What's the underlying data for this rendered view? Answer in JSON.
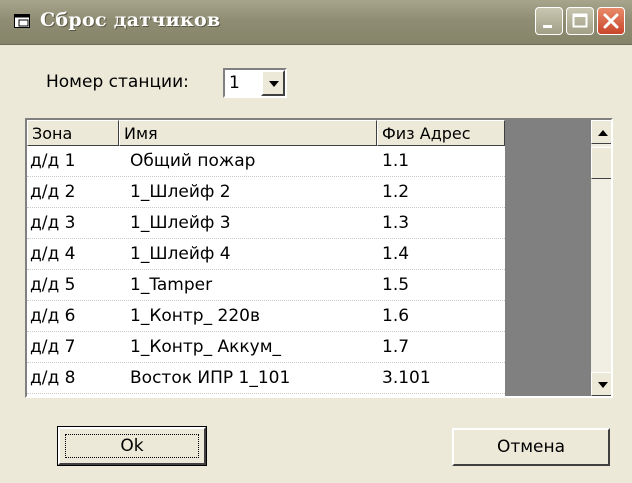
{
  "window": {
    "title": "Сброс датчиков",
    "accent_color": "#8f8d73"
  },
  "station": {
    "label": "Номер станции:",
    "value": "1"
  },
  "table": {
    "headers": {
      "zone": "Зона",
      "name": "Имя",
      "address": "Физ Адрес"
    },
    "rows": [
      {
        "zone": "д/д 1",
        "name": "Общий пожар",
        "address": "1.1"
      },
      {
        "zone": "д/д 2",
        "name": "1_Шлейф 2",
        "address": "1.2"
      },
      {
        "zone": "д/д 3",
        "name": "1_Шлейф 3",
        "address": "1.3"
      },
      {
        "zone": "д/д 4",
        "name": "1_Шлейф 4",
        "address": "1.4"
      },
      {
        "zone": "д/д 5",
        "name": "1_Tamper",
        "address": "1.5"
      },
      {
        "zone": "д/д 6",
        "name": "1_Контр_ 220в",
        "address": "1.6"
      },
      {
        "zone": "д/д 7",
        "name": "1_Контр_ Аккум_",
        "address": "1.7"
      },
      {
        "zone": "д/д 8",
        "name": "Восток ИПР 1_101",
        "address": "3.101"
      }
    ]
  },
  "buttons": {
    "ok": "Ok",
    "cancel": "Отмена"
  },
  "icons": {
    "title": "window-app-icon",
    "minimize": "minimize-icon",
    "maximize": "maximize-icon",
    "close": "close-icon",
    "dropdown": "chevron-down-icon",
    "scroll_up": "scroll-up-arrow-icon",
    "scroll_down": "scroll-down-arrow-icon"
  }
}
